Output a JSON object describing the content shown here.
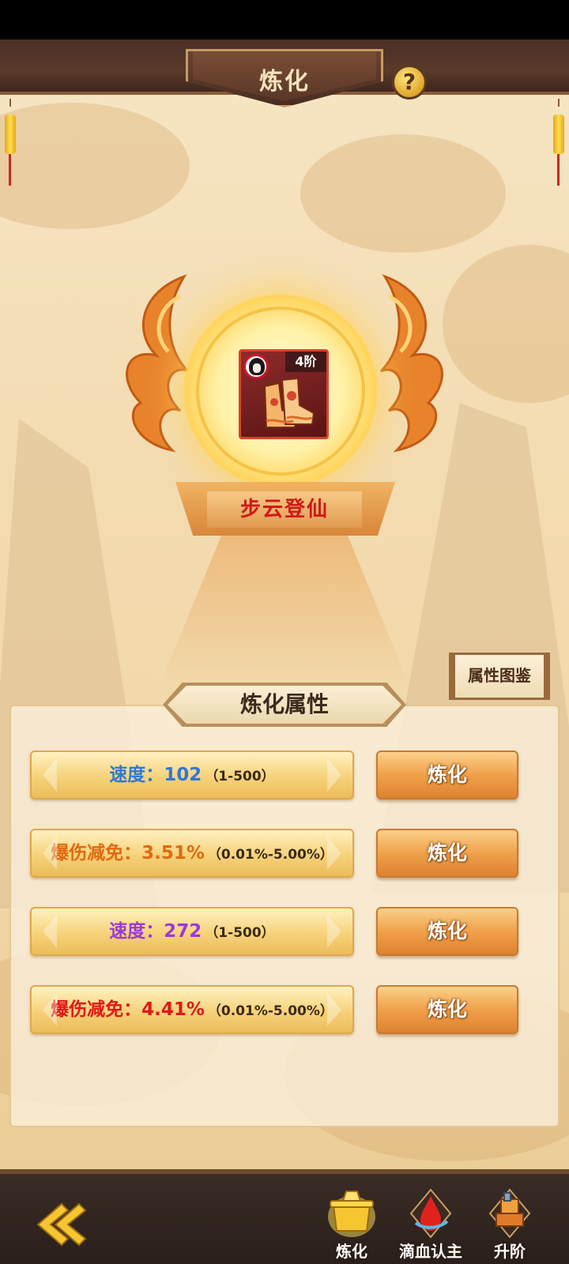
{
  "header": {
    "title": "炼化",
    "help_label": "?"
  },
  "item": {
    "name": "步云登仙",
    "tier": "4阶",
    "icon": "boots-icon"
  },
  "codex_button": "属性图鉴",
  "panel": {
    "title": "炼化属性",
    "attributes": [
      {
        "name": "速度：",
        "value": "102",
        "range": "（1-500）",
        "color": "#2f78d8"
      },
      {
        "name": "爆伤减免：",
        "value": "3.51%",
        "range": "（0.01%-5.00%）",
        "color": "#e06a10"
      },
      {
        "name": "速度：",
        "value": "272",
        "range": "（1-500）",
        "color": "#9a3ad8"
      },
      {
        "name": "爆伤减免：",
        "value": "4.41%",
        "range": "（0.01%-5.00%）",
        "color": "#e01818"
      }
    ],
    "refine_label": "炼化"
  },
  "bottom_nav": {
    "back_icon": "back-arrow-icon",
    "tabs": [
      {
        "label": "炼化",
        "icon": "cauldron-icon"
      },
      {
        "label": "滴血认主",
        "icon": "blood-drop-icon"
      },
      {
        "label": "升阶",
        "icon": "anvil-icon"
      }
    ]
  }
}
